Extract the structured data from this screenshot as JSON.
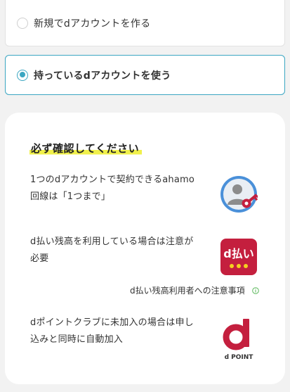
{
  "options": [
    {
      "label": "新規でdアカウントを作る",
      "selected": false
    },
    {
      "label": "持っているdアカウントを使う",
      "selected": true
    }
  ],
  "card": {
    "title": "必ず確認してください",
    "items": [
      {
        "line1": "1つのdアカウントで契約できるahamo",
        "line2": "回線は「1つまで」",
        "icon": "user-key-icon"
      },
      {
        "line1": "d払い残高を利用している場合は注意が",
        "line2": "必要",
        "icon": "d-barai-icon"
      },
      {
        "line1": "dポイントクラブに未加入の場合は申し",
        "line2": "込みと同時に自動加入",
        "icon": "d-point-icon"
      }
    ],
    "note_link": "d払い残高利用者への注意事項",
    "dpay_logo_text": "d払い",
    "dpoint_logo_text": "d POINT"
  },
  "colors": {
    "accent": "#3ba6c2",
    "dpay_red": "#c41f3e",
    "highlight": "#f0f04a",
    "info_green": "#5cb85c"
  }
}
